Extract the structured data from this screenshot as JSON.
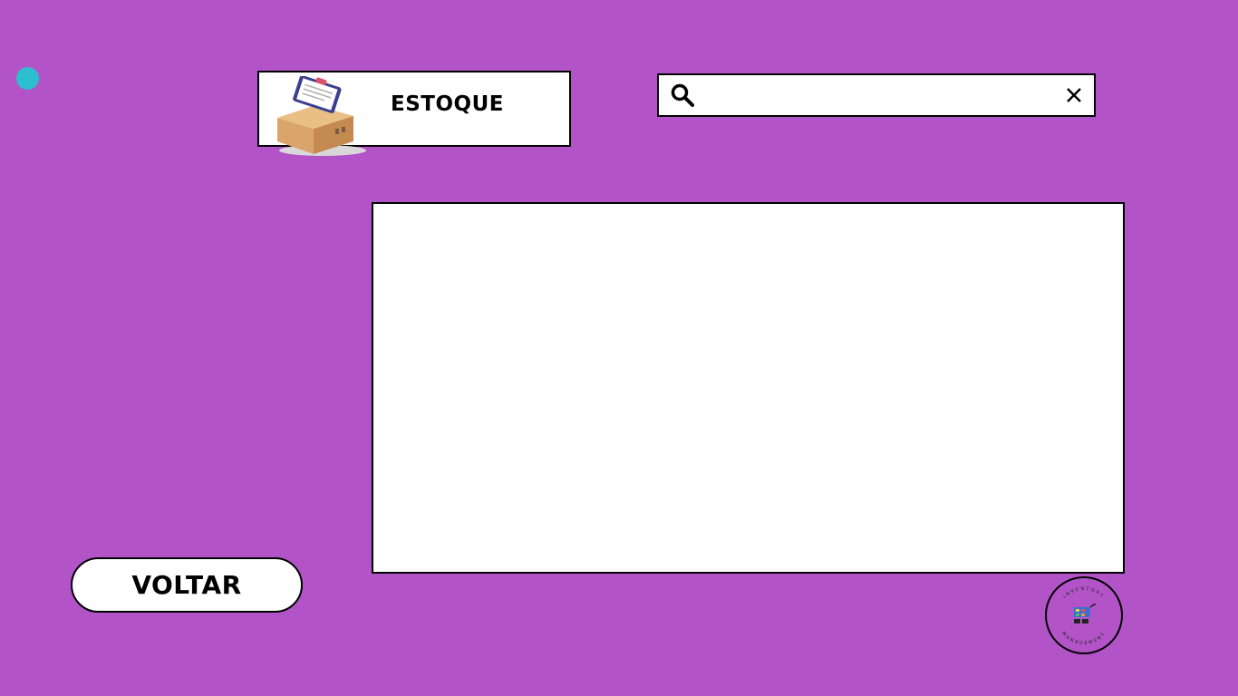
{
  "header": {
    "title": "ESTOQUE",
    "icon": "inventory-box-clipboard-icon"
  },
  "search": {
    "value": "",
    "placeholder": "",
    "icon": "search-icon",
    "clear_icon": "close-icon"
  },
  "navigation": {
    "back_label": "VOLTAR"
  },
  "logo": {
    "top_text": "INVENTORY",
    "bottom_text": "MANAGEMENT",
    "icon": "shopping-cart-icon"
  },
  "colors": {
    "background": "#b254c8",
    "accent_dot": "#2bbfcf",
    "panel": "#ffffff",
    "border": "#000000"
  }
}
